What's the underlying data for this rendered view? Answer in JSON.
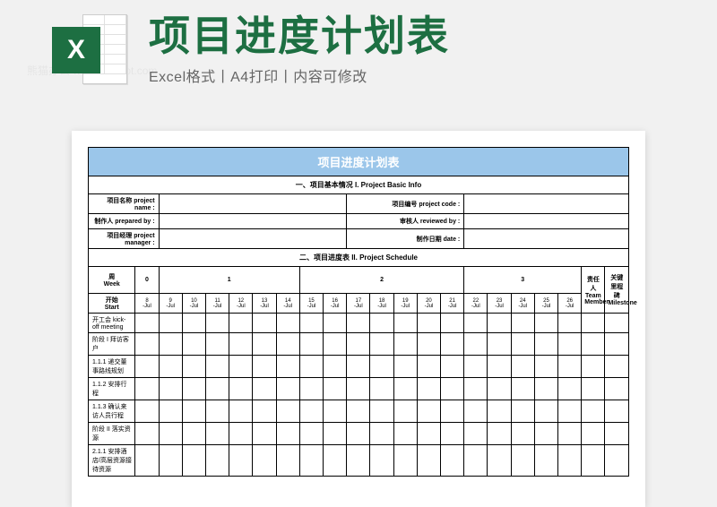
{
  "header": {
    "title": "项目进度计划表",
    "subtitle": "Excel格式丨A4打印丨内容可修改",
    "icon_letter": "X"
  },
  "watermark": "熊猫办公 www.tukuppt.com",
  "sheet": {
    "title": "项目进度计划表",
    "section1": "一、项目基本情况  I. Project Basic Info",
    "info_rows": [
      {
        "l1": "项目名称 project name :",
        "l2": "项目编号 project code :"
      },
      {
        "l1": "制作人 prepared by :",
        "l2": "审核人 reviewed by :"
      },
      {
        "l1": "项目经理 project manager :",
        "l2": "制作日期 date :"
      }
    ],
    "section2": "二、项目进度表  II. Project Schedule",
    "week_label": "周\nWeek",
    "weeks": [
      "0",
      "1",
      "2",
      "3"
    ],
    "team_col": "责任人 Team Member",
    "milestone_col": "关键里程碑 Milestone",
    "start_label": "开始\nStart",
    "dates": [
      "8\n-Jul",
      "9\n-Jul",
      "10\n-Jul",
      "11\n-Jul",
      "12\n-Jul",
      "13\n-Jul",
      "14\n-Jul",
      "15\n-Jul",
      "16\n-Jul",
      "17\n-Jul",
      "18\n-Jul",
      "19\n-Jul",
      "20\n-Jul",
      "21\n-Jul",
      "22\n-Jul",
      "23\n-Jul",
      "24\n-Jul",
      "25\n-Jul",
      "26\n-Jul"
    ],
    "tasks": [
      "开工会 kick-off meeting",
      "阶段 I 拜访客户",
      "1.1.1 递交董事路线规划",
      "1.1.2 安排行程",
      "1.1.3 确认来访人员行程",
      "阶段 II 落实资源",
      "2.1.1 安排酒店/高层资源接待资源"
    ]
  }
}
